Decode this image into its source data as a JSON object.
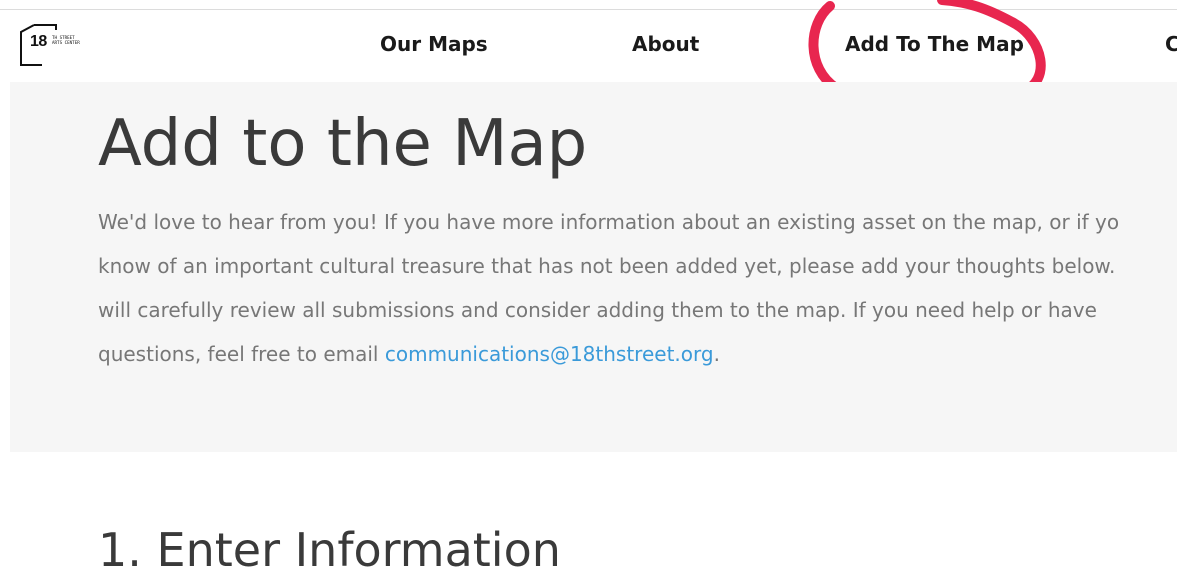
{
  "logo": {
    "number": "18",
    "line1": "TH STREET",
    "line2": "ARTS CENTER"
  },
  "nav": {
    "items": [
      {
        "label": "Our Maps"
      },
      {
        "label": "About"
      },
      {
        "label": "Add To The Map"
      },
      {
        "label": "C"
      }
    ]
  },
  "hero": {
    "title": "Add to the Map",
    "lines": [
      "We'd love to hear from you! If you have more information about an existing asset on the map, or if yo",
      "know of an important cultural treasure that has not been added yet, please add your thoughts below.",
      "will carefully review all submissions and consider adding them to the map. If you need help or have",
      "questions, feel free to email "
    ],
    "email": "communications@18thstreet.org",
    "email_suffix": "."
  },
  "section": {
    "title": "1. Enter Information"
  },
  "colors": {
    "hero_background": "#f6f6f6",
    "link": "#3a9ad9",
    "annotation_circle": "#e8264f",
    "title_text": "#3a3a3a",
    "body_text": "#777777"
  }
}
